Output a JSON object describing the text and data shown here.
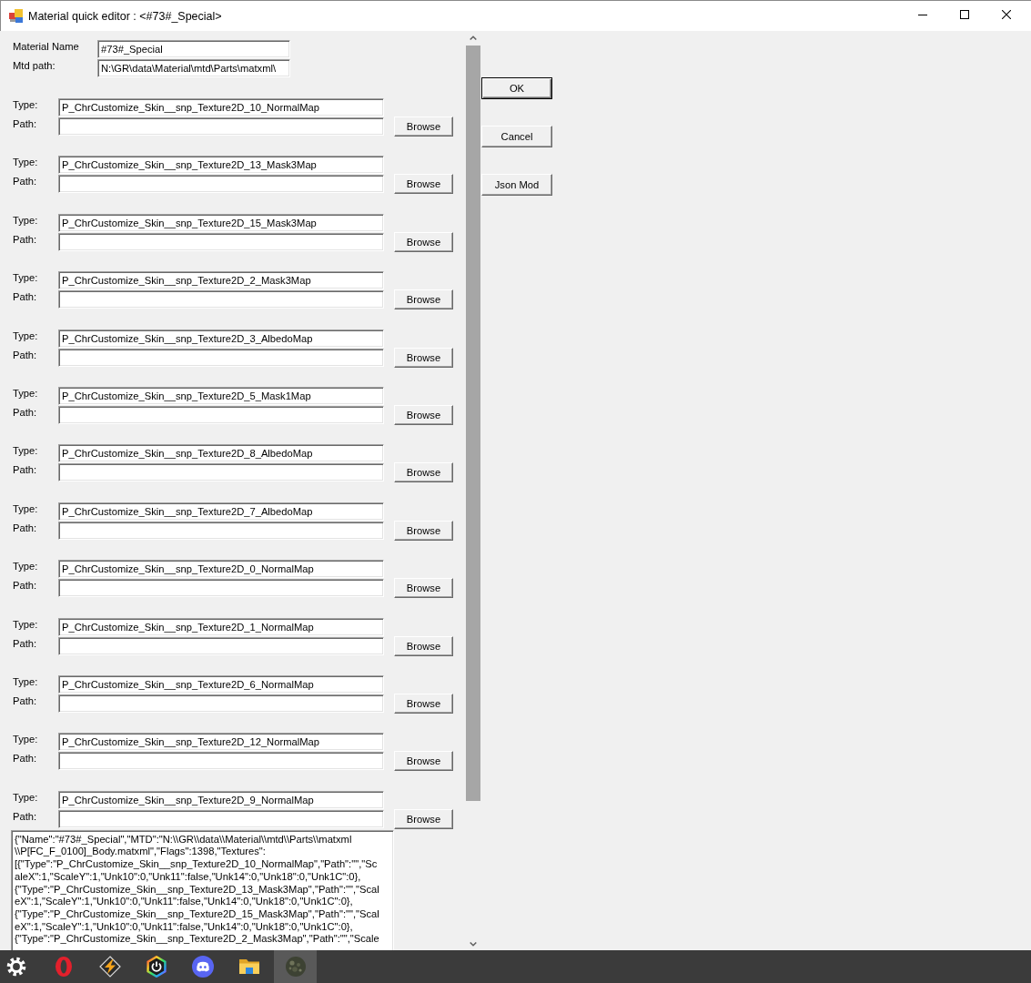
{
  "window": {
    "title": "Material quick editor : <#73#_Special>"
  },
  "material": {
    "name_label": "Material Name",
    "name": "#73#_Special",
    "mtd_label": "Mtd path:",
    "mtd_path": "N:\\GR\\data\\Material\\mtd\\Parts\\matxml\\"
  },
  "textures": [
    {
      "type_label": "Type:",
      "type": "P_ChrCustomize_Skin__snp_Texture2D_10_NormalMap",
      "path_label": "Path:",
      "browse": "Browse"
    },
    {
      "type_label": "Type:",
      "type": "P_ChrCustomize_Skin__snp_Texture2D_13_Mask3Map",
      "path_label": "Path:",
      "browse": "Browse"
    },
    {
      "type_label": "Type:",
      "type": "P_ChrCustomize_Skin__snp_Texture2D_15_Mask3Map",
      "path_label": "Path:",
      "browse": "Browse"
    },
    {
      "type_label": "Type:",
      "type": "P_ChrCustomize_Skin__snp_Texture2D_2_Mask3Map",
      "path_label": "Path:",
      "browse": "Browse"
    },
    {
      "type_label": "Type:",
      "type": "P_ChrCustomize_Skin__snp_Texture2D_3_AlbedoMap",
      "path_label": "Path:",
      "browse": "Browse"
    },
    {
      "type_label": "Type:",
      "type": "P_ChrCustomize_Skin__snp_Texture2D_5_Mask1Map",
      "path_label": "Path:",
      "browse": "Browse"
    },
    {
      "type_label": "Type:",
      "type": "P_ChrCustomize_Skin__snp_Texture2D_8_AlbedoMap",
      "path_label": "Path:",
      "browse": "Browse"
    },
    {
      "type_label": "Type:",
      "type": "P_ChrCustomize_Skin__snp_Texture2D_7_AlbedoMap",
      "path_label": "Path:",
      "browse": "Browse"
    },
    {
      "type_label": "Type:",
      "type": "P_ChrCustomize_Skin__snp_Texture2D_0_NormalMap",
      "path_label": "Path:",
      "browse": "Browse"
    },
    {
      "type_label": "Type:",
      "type": "P_ChrCustomize_Skin__snp_Texture2D_1_NormalMap",
      "path_label": "Path:",
      "browse": "Browse"
    },
    {
      "type_label": "Type:",
      "type": "P_ChrCustomize_Skin__snp_Texture2D_6_NormalMap",
      "path_label": "Path:",
      "browse": "Browse"
    },
    {
      "type_label": "Type:",
      "type": "P_ChrCustomize_Skin__snp_Texture2D_12_NormalMap",
      "path_label": "Path:",
      "browse": "Browse"
    },
    {
      "type_label": "Type:",
      "type": "P_ChrCustomize_Skin__snp_Texture2D_9_NormalMap",
      "path_label": "Path:",
      "browse": "Browse"
    }
  ],
  "json_text": {
    "lines": [
      "{\"Name\":\"#73#_Special\",\"MTD\":\"N:\\\\GR\\\\data\\\\Material\\\\mtd\\\\Parts\\\\matxml",
      "\\\\P[FC_F_0100]_Body.matxml\",\"Flags\":1398,\"Textures\":",
      "[{\"Type\":\"P_ChrCustomize_Skin__snp_Texture2D_10_NormalMap\",\"Path\":\"\",\"Sc",
      "aleX\":1,\"ScaleY\":1,\"Unk10\":0,\"Unk11\":false,\"Unk14\":0,\"Unk18\":0,\"Unk1C\":0},",
      "{\"Type\":\"P_ChrCustomize_Skin__snp_Texture2D_13_Mask3Map\",\"Path\":\"\",\"Scal",
      "eX\":1,\"ScaleY\":1,\"Unk10\":0,\"Unk11\":false,\"Unk14\":0,\"Unk18\":0,\"Unk1C\":0},",
      "{\"Type\":\"P_ChrCustomize_Skin__snp_Texture2D_15_Mask3Map\",\"Path\":\"\",\"Scal",
      "eX\":1,\"ScaleY\":1,\"Unk10\":0,\"Unk11\":false,\"Unk14\":0,\"Unk18\":0,\"Unk1C\":0},",
      "{\"Type\":\"P_ChrCustomize_Skin__snp_Texture2D_2_Mask3Map\",\"Path\":\"\",\"Scale"
    ]
  },
  "buttons": [
    {
      "label": "OK",
      "default": true
    },
    {
      "label": "Cancel",
      "default": false
    },
    {
      "label": "Json Mod",
      "default": false
    }
  ],
  "taskbar": {
    "items": [
      {
        "kind": "gear",
        "selected": false
      },
      {
        "kind": "ring",
        "selected": false
      },
      {
        "kind": "bolt",
        "selected": false
      },
      {
        "kind": "hexagon",
        "selected": false
      },
      {
        "kind": "mascot",
        "selected": false
      },
      {
        "kind": "folder",
        "selected": false
      },
      {
        "kind": "stone",
        "selected": true
      }
    ]
  }
}
